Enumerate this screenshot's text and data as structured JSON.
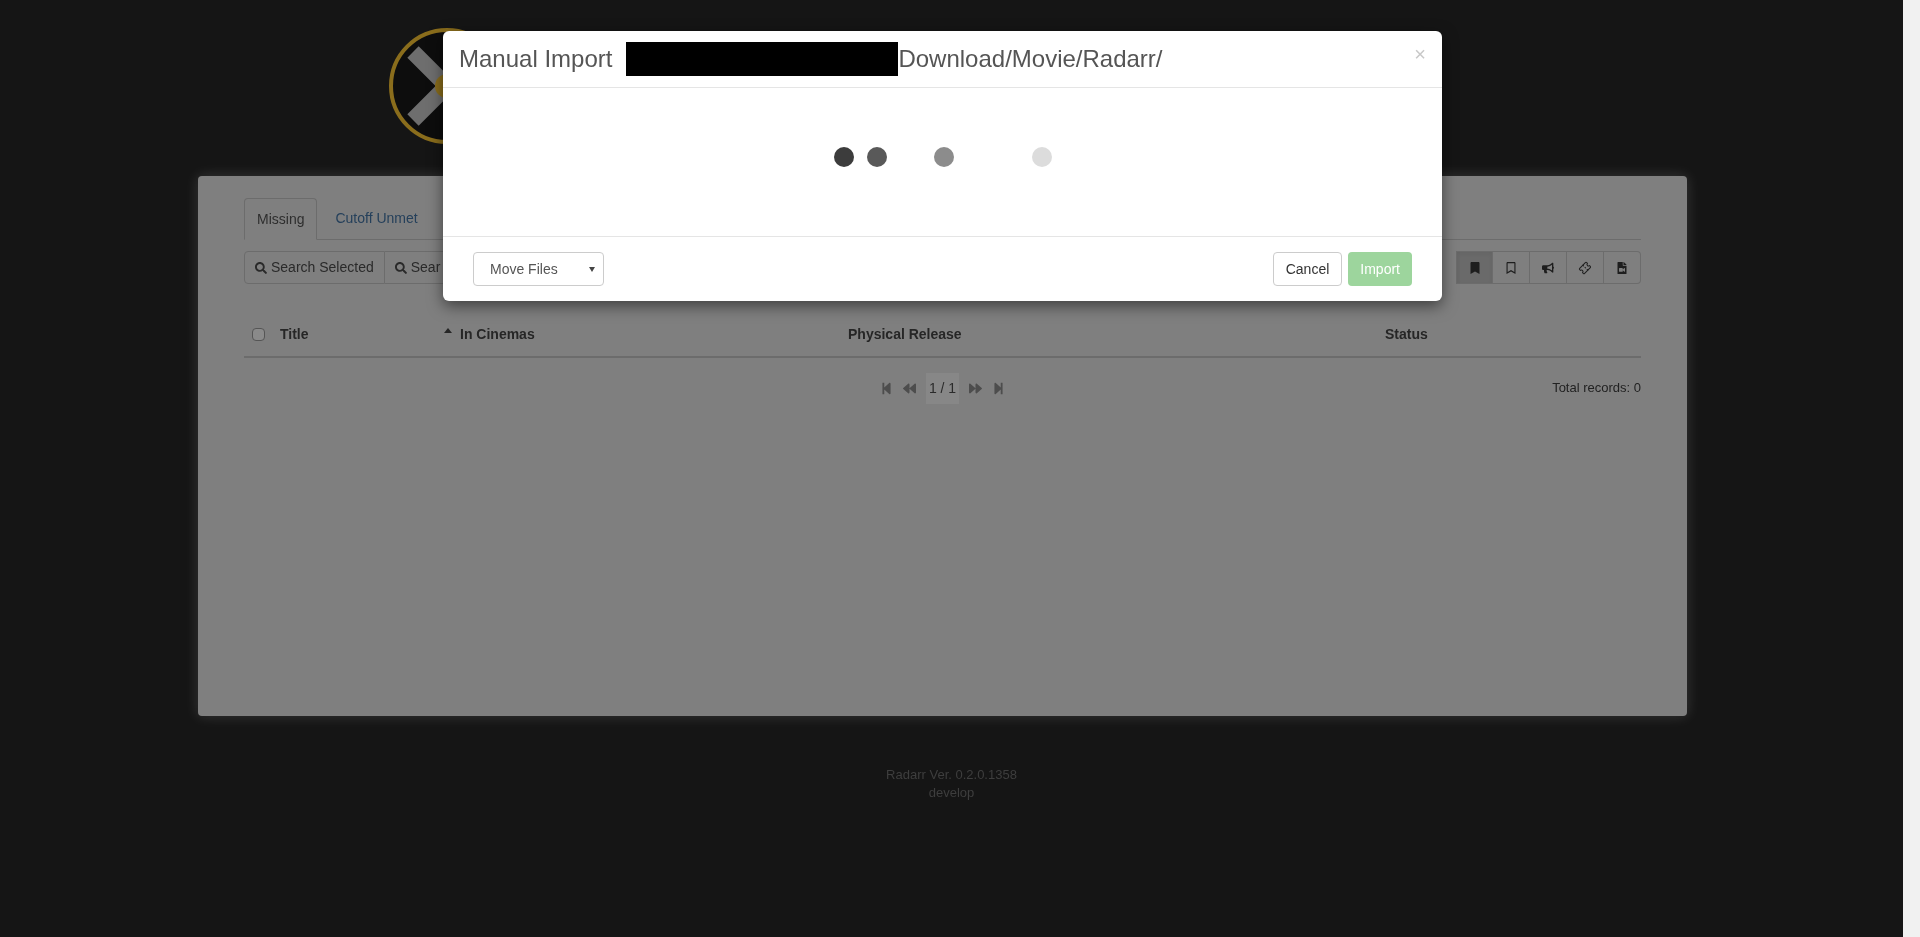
{
  "page": {
    "tabs": [
      {
        "label": "Missing",
        "selected": true
      },
      {
        "label": "Cutoff Unmet",
        "selected": false
      }
    ],
    "toolbar_left": [
      "Search Selected",
      "Sear"
    ],
    "toolbar_right": [
      {
        "kind": "bookmark-filled",
        "selected": true
      },
      {
        "kind": "bookmark-outline",
        "selected": false
      },
      {
        "kind": "megaphone",
        "selected": false
      },
      {
        "kind": "ticket",
        "selected": false
      },
      {
        "kind": "film-file",
        "selected": false
      }
    ],
    "table": {
      "select_all_checked": false,
      "columns": [
        {
          "label": "Title",
          "sorted": false
        },
        {
          "label": "In Cinemas",
          "sorted": true
        },
        {
          "label": "Physical Release",
          "sorted": false
        },
        {
          "label": "Status",
          "sorted": false
        }
      ]
    },
    "pagination": {
      "page": "1 / 1",
      "total": "Total records: 0"
    },
    "footer": {
      "version": "Radarr Ver. 0.2.0.1358",
      "branch": "develop"
    }
  },
  "modal": {
    "title_prefix": "Manual Import",
    "title_suffix": "Download/Movie/Radarr/",
    "close": "×",
    "mode_select": "Move Files",
    "buttons": [
      {
        "label": "Cancel",
        "kind": "default",
        "disabled": false
      },
      {
        "label": "Import",
        "kind": "primary",
        "disabled": true
      }
    ]
  }
}
